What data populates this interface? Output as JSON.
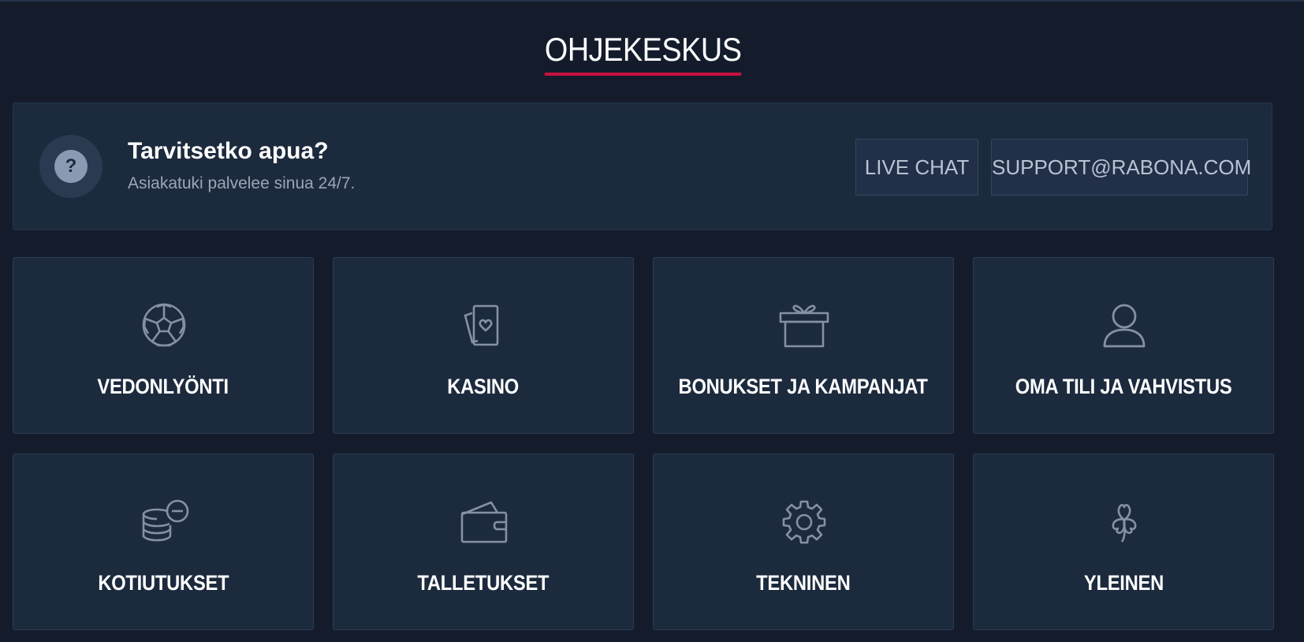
{
  "page": {
    "title": "OHJEKESKUS",
    "accent_color": "#c8103e",
    "background_color": "#141c2c"
  },
  "help_banner": {
    "icon": "question-icon",
    "title": "Tarvitsetko apua?",
    "subtitle": "Asiakatuki palvelee sinua 24/7.",
    "live_chat_label": "LIVE CHAT",
    "support_email_label": "SUPPORT@RABONA.COM"
  },
  "categories": [
    {
      "label": "VEDONLYÖNTI",
      "icon": "football-icon"
    },
    {
      "label": "KASINO",
      "icon": "cards-icon"
    },
    {
      "label": "BONUKSET JA KAMPANJAT",
      "icon": "gift-icon"
    },
    {
      "label": "OMA TILI JA VAHVISTUS",
      "icon": "user-icon"
    },
    {
      "label": "KOTIUTUKSET",
      "icon": "coins-icon"
    },
    {
      "label": "TALLETUKSET",
      "icon": "wallet-icon"
    },
    {
      "label": "TEKNINEN",
      "icon": "gear-icon"
    },
    {
      "label": "YLEINEN",
      "icon": "clover-icon"
    }
  ]
}
